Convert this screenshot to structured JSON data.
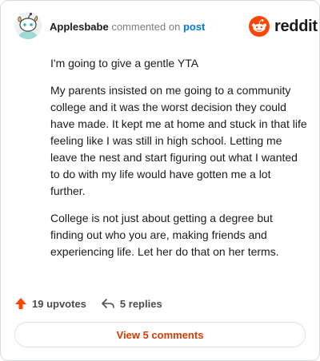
{
  "comment": {
    "author": "Applesbabe",
    "action_text": "commented on",
    "target_link": "post",
    "paragraphs": [
      "I'm going to give a gentle YTA",
      "My parents insisted on me going to a community college and it was the worst decision they could have made. It kept me at home and stuck in that life feeling like I was still in high school. Letting me leave the nest and start figuring out what I wanted to do with my life would have gotten me a lot further.",
      "College is not just about getting a degree but finding out who you are, making friends and experiencing life. Let her do that on her terms."
    ]
  },
  "brand": {
    "name": "reddit",
    "color": "#ff4500"
  },
  "actions": {
    "upvotes_label": "19 upvotes",
    "replies_label": "5 replies"
  },
  "view_comments_label": "View 5 comments",
  "colors": {
    "accent": "#d93900",
    "link": "#0079d3",
    "upvote": "#ff4500"
  },
  "icons": {
    "avatar": "snoo-avatar",
    "upvote": "upvote-arrow-icon",
    "reply": "reply-arrow-icon",
    "brand": "reddit-logo-icon"
  }
}
